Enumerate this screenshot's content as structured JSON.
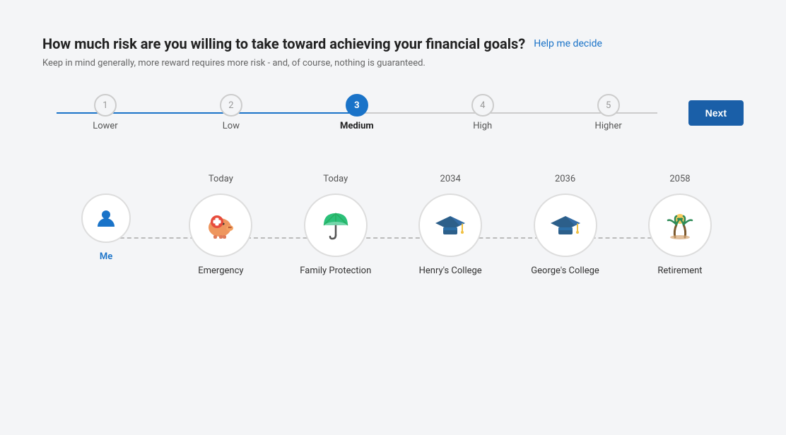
{
  "question": {
    "title": "How much risk are you willing to take toward achieving your financial goals?",
    "help_text": "Help me decide",
    "subtitle": "Keep in mind generally, more reward requires more risk - and, of course, nothing is guaranteed."
  },
  "risk_steps": [
    {
      "number": "1",
      "label": "Lower",
      "active": false
    },
    {
      "number": "2",
      "label": "Low",
      "active": false
    },
    {
      "number": "3",
      "label": "Medium",
      "active": true
    },
    {
      "number": "4",
      "label": "High",
      "active": false
    },
    {
      "number": "5",
      "label": "Higher",
      "active": false
    }
  ],
  "next_button": "Next",
  "timeline": {
    "items": [
      {
        "year": "",
        "name": "Me",
        "icon": "me"
      },
      {
        "year": "Today",
        "name": "Emergency",
        "icon": "emergency"
      },
      {
        "year": "Today",
        "name": "Family Protection",
        "icon": "family"
      },
      {
        "year": "2034",
        "name": "Henry's College",
        "icon": "college1"
      },
      {
        "year": "2036",
        "name": "George's College",
        "icon": "college2"
      },
      {
        "year": "2058",
        "name": "Retirement",
        "icon": "retirement"
      }
    ]
  }
}
